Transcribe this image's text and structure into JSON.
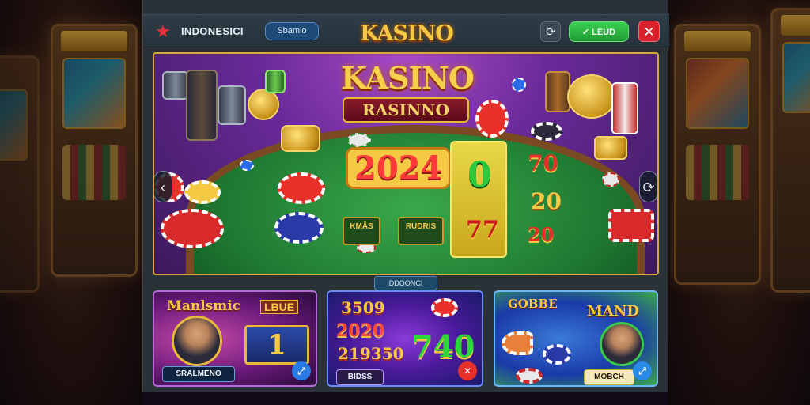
{
  "header": {
    "brand_name": "INDONESICI",
    "balance_label": "Sbamio",
    "logo_text": "KASINO",
    "login_label": "LEUD",
    "icons": {
      "brand": "star-icon",
      "refresh": "refresh-icon",
      "close": "close-icon"
    }
  },
  "hero": {
    "title": "KASINO",
    "subtitle": "RASINNO",
    "main_number": "2024",
    "reel_top": "0",
    "reel_bottom": "77",
    "side_numbers": [
      "70",
      "20",
      "20"
    ],
    "mini_cards": [
      "KMÅS",
      "RUDRIS"
    ],
    "nav": {
      "prev": "chevron-left-icon",
      "next": "chevron-right-icon"
    }
  },
  "section": {
    "label": "DDOONCI"
  },
  "cards": [
    {
      "title": "Manlsmic",
      "badge": "LBUE",
      "prize": "1",
      "name": "SRALMENO",
      "action_icon": "expand-icon"
    },
    {
      "numbers": [
        "3509",
        "2020",
        "219350"
      ],
      "big": "740",
      "name": "BIDSS",
      "action_icon": "close-icon"
    },
    {
      "title": "GOBBE",
      "title2": "MAND",
      "name": "MOBCH",
      "action_icon": "expand-icon"
    }
  ],
  "colors": {
    "accent_gold": "#f6c945",
    "login_green": "#2ec544",
    "close_red": "#d8232f",
    "felt_green": "#1f7a32"
  }
}
